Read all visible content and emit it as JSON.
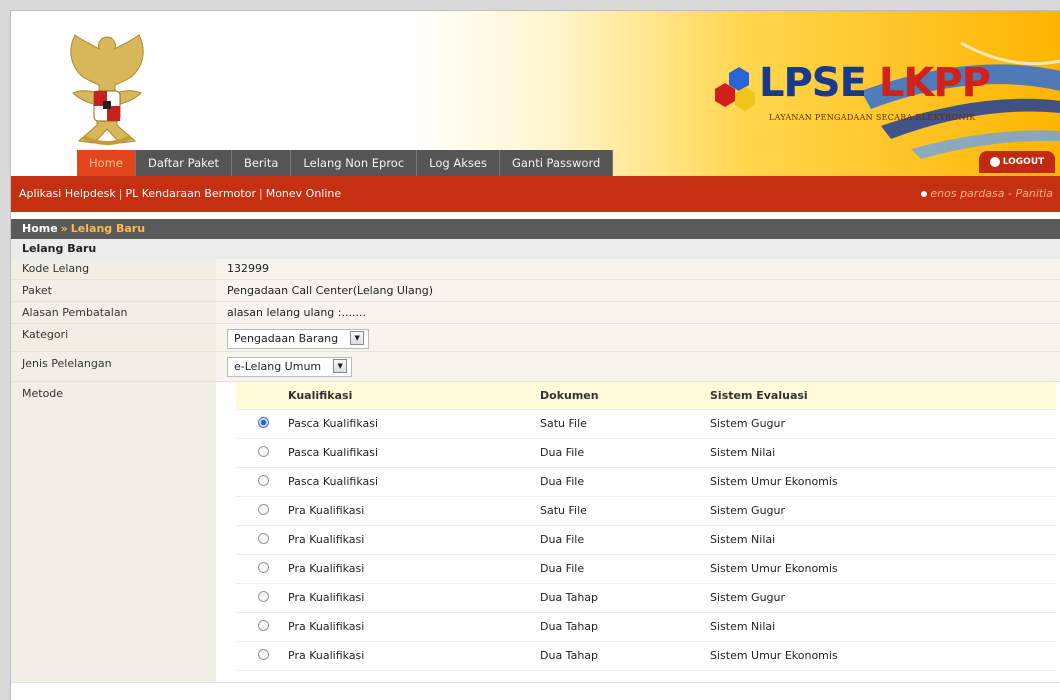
{
  "nav": {
    "tabs": [
      "Home",
      "Daftar Paket",
      "Berita",
      "Lelang Non Eproc",
      "Log Akses",
      "Ganti Password"
    ],
    "active_index": 0,
    "logout_label": "LOGOUT"
  },
  "brand": {
    "name_part1": "LPSE",
    "name_part2": "LKPP",
    "tagline": "LAYANAN PENGADAAN SECARA ELEKTRONIK"
  },
  "subnav": {
    "links": [
      "Aplikasi Helpdesk",
      "PL Kendaraan Bermotor",
      "Monev Online"
    ],
    "user": "enos pardasa - Panitia"
  },
  "breadcrumb": {
    "home": "Home",
    "current": "Lelang Baru"
  },
  "section_title": "Lelang Baru",
  "form": {
    "kode_label": "Kode Lelang",
    "kode_value": "132999",
    "paket_label": "Paket",
    "paket_value": "Pengadaan Call Center(Lelang Ulang)",
    "alasan_label": "Alasan Pembatalan",
    "alasan_value": "alasan lelang ulang :.......",
    "kategori_label": "Kategori",
    "kategori_value": "Pengadaan Barang",
    "jenis_label": "Jenis Pelelangan",
    "jenis_value": "e-Lelang Umum",
    "metode_label": "Metode"
  },
  "metode": {
    "headers": [
      "Kualifikasi",
      "Dokumen",
      "Sistem Evaluasi"
    ],
    "selected_index": 0,
    "rows": [
      [
        "Pasca Kualifikasi",
        "Satu File",
        "Sistem Gugur"
      ],
      [
        "Pasca Kualifikasi",
        "Dua File",
        "Sistem Nilai"
      ],
      [
        "Pasca Kualifikasi",
        "Dua File",
        "Sistem Umur Ekonomis"
      ],
      [
        "Pra Kualifikasi",
        "Satu File",
        "Sistem Gugur"
      ],
      [
        "Pra Kualifikasi",
        "Dua File",
        "Sistem Nilai"
      ],
      [
        "Pra Kualifikasi",
        "Dua File",
        "Sistem Umur Ekonomis"
      ],
      [
        "Pra Kualifikasi",
        "Dua Tahap",
        "Sistem Gugur"
      ],
      [
        "Pra Kualifikasi",
        "Dua Tahap",
        "Sistem Nilai"
      ],
      [
        "Pra Kualifikasi",
        "Dua Tahap",
        "Sistem Umur Ekonomis"
      ]
    ]
  },
  "colors": {
    "header_red": "#c52f12",
    "nav_gray": "#555555",
    "active_tab": "#e3461d",
    "accent_orange": "#ffb84d"
  }
}
